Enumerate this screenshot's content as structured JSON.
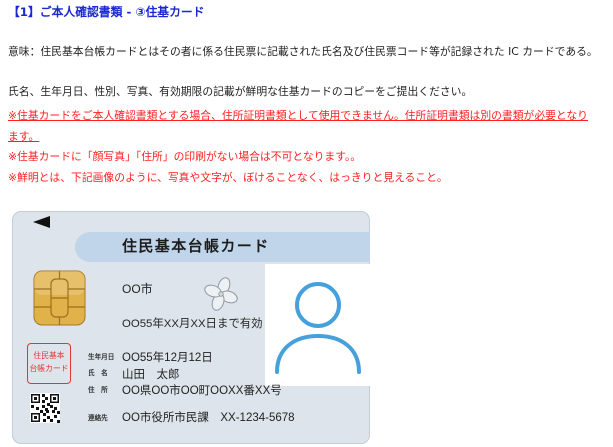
{
  "heading": "【1】ご本人確認書類 - ③住基カード",
  "meaning": "意味：住民基本台帳カードとはその者に係る住民票に記載された氏名及び住民票コード等が記録された IC カードである。",
  "instruction": "氏名、生年月日、性別、写真、有効期限の記載が鮮明な住基カードのコピーをご提出ください。",
  "notes": [
    "※住基カードをご本人確認書類とする場合、住所証明書類として使用できません。住所証明書類は別の書類が必要となります。",
    "※住基カードに「顔写真」「住所」の印刷がない場合は不可となります。。",
    "※鮮明とは、下記画像のように、写真や文字が、ぼけることなく、はっきりと見えること。"
  ],
  "card": {
    "title": "住民基本台帳カード",
    "municipality": "OO市",
    "validity": "OO55年XX月XX日まで有効",
    "stamp_line1": "住民基本",
    "stamp_line2": "台帳カード",
    "fields": [
      {
        "label": "生年月日",
        "value": "OO55年12月12日"
      },
      {
        "label": "氏　名",
        "value": "山田　太郎"
      },
      {
        "label": "住　所",
        "value": "OO県OO市OO町OOXX番XX号"
      },
      {
        "label": "連絡先",
        "value": "OO市役所市民課　XX-1234-5678"
      }
    ]
  },
  "icons": {
    "card_arrow": "triangle-left-icon",
    "chip": "ic-chip-icon",
    "logo": "flower-emblem-icon",
    "photo": "person-silhouette-icon",
    "qr": "qr-code-icon"
  },
  "colors": {
    "heading": "#1a28d4",
    "note": "#ff1f1f",
    "body_text": "#1e1e1e",
    "card_bg": "#dde4eb",
    "card_band": "#c0d5ea",
    "silhouette": "#45a0db",
    "chip": "#e1b24a",
    "stamp": "#e2352d"
  }
}
